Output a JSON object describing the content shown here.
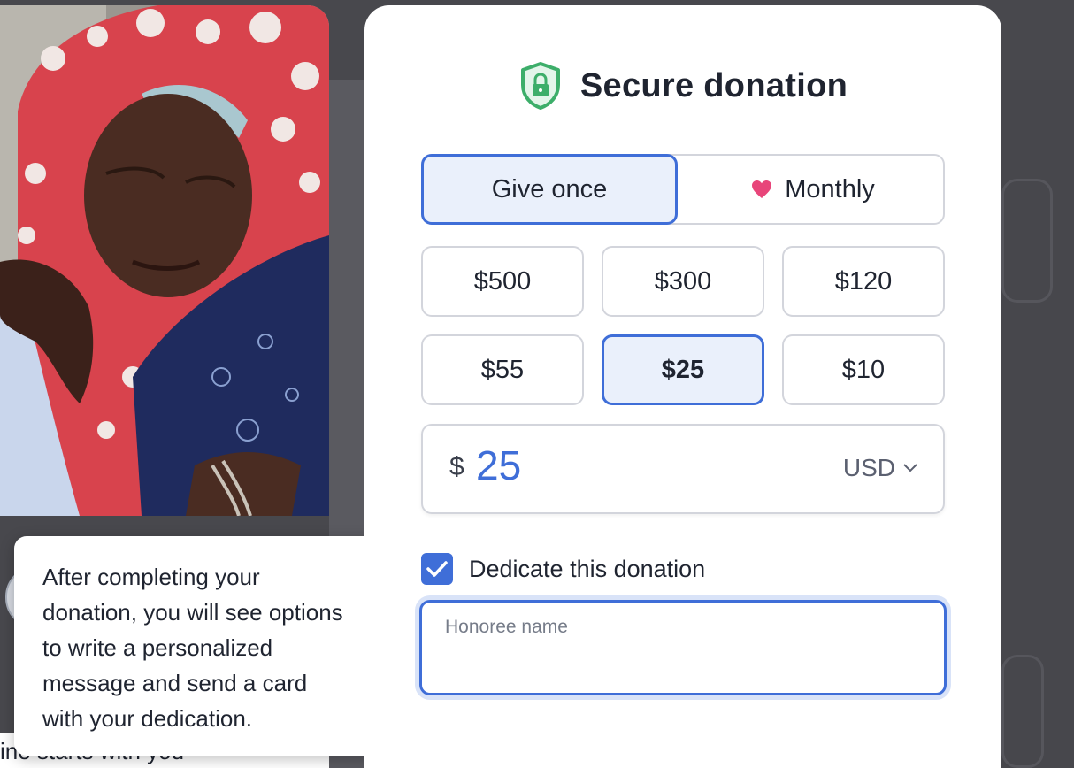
{
  "modal": {
    "title": "Secure donation",
    "frequency": {
      "once_label": "Give once",
      "monthly_label": "Monthly",
      "selected": "Give once"
    },
    "amounts": [
      {
        "label": "$500",
        "selected": false
      },
      {
        "label": "$300",
        "selected": false
      },
      {
        "label": "$120",
        "selected": false
      },
      {
        "label": "$55",
        "selected": false
      },
      {
        "label": "$25",
        "selected": true
      },
      {
        "label": "$10",
        "selected": false
      }
    ],
    "amount_input": {
      "currency_symbol": "$",
      "value": "25",
      "currency_code": "USD"
    },
    "dedicate": {
      "label": "Dedicate this donation",
      "checked": true
    },
    "honoree": {
      "placeholder": "Honoree name",
      "value": ""
    }
  },
  "tooltip": {
    "lines": [
      "After completing your",
      "donation, you will see options",
      "to write a personalized",
      "message and send a card",
      "with your dedication."
    ]
  },
  "background": {
    "bottom_text": "ine starts with you"
  },
  "colors": {
    "accent": "#3f6ed8",
    "accent_light": "#eaf0fb",
    "shield_green": "#3dae6a",
    "heart_pink": "#e8457a",
    "overlay": "#48484d"
  },
  "icons": {
    "shield": "shield-lock-icon",
    "heart": "heart-icon",
    "chevron": "chevron-down-icon",
    "check": "checkmark-icon"
  }
}
